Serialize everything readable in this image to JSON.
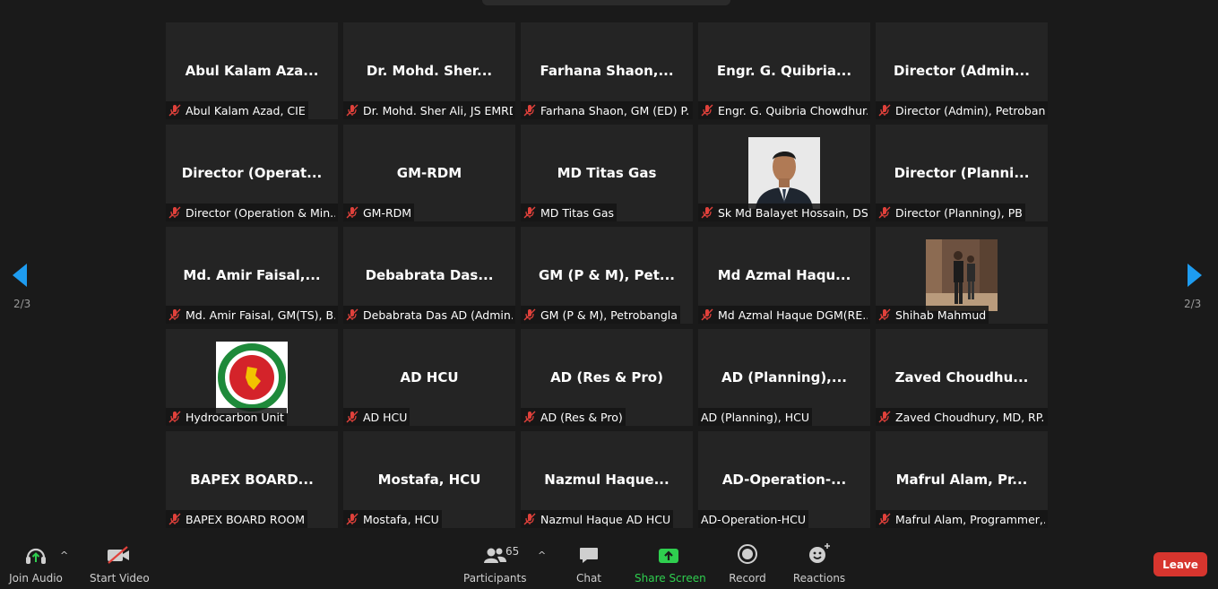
{
  "page": {
    "current": "2",
    "total": "3",
    "indicator": "2/3"
  },
  "tiles": [
    {
      "title": "Abul Kalam Aza...",
      "name": "Abul Kalam Azad, CIE",
      "muted": true,
      "photo": ""
    },
    {
      "title": "Dr. Mohd. Sher...",
      "name": "Dr. Mohd. Sher Ali, JS EMRD",
      "muted": true,
      "photo": ""
    },
    {
      "title": "Farhana  Shaon,...",
      "name": "Farhana Shaon, GM (ED) P...",
      "muted": true,
      "photo": ""
    },
    {
      "title": "Engr. G. Quibria...",
      "name": "Engr. G. Quibria Chowdhur...",
      "muted": true,
      "photo": ""
    },
    {
      "title": "Director  (Admin...",
      "name": "Director (Admin), Petroban...",
      "muted": true,
      "photo": ""
    },
    {
      "title": "Director  (Operat...",
      "name": "Director (Operation & Min...",
      "muted": true,
      "photo": ""
    },
    {
      "title": "GM-RDM",
      "name": "GM-RDM",
      "muted": true,
      "photo": ""
    },
    {
      "title": "MD Titas Gas",
      "name": "MD Titas Gas",
      "muted": true,
      "photo": ""
    },
    {
      "title": "",
      "name": "Sk Md Balayet Hossain, DS...",
      "muted": true,
      "photo": "portrait"
    },
    {
      "title": "Director  (Planni...",
      "name": "Director (Planning), PB",
      "muted": true,
      "photo": ""
    },
    {
      "title": "Md. Amir Faisal,...",
      "name": "Md. Amir Faisal, GM(TS), B...",
      "muted": true,
      "photo": ""
    },
    {
      "title": "Debabrata Das...",
      "name": "Debabrata Das AD (Admin...",
      "muted": true,
      "photo": ""
    },
    {
      "title": "GM (P & M), Pet...",
      "name": "GM (P & M), Petrobangla",
      "muted": true,
      "photo": ""
    },
    {
      "title": "Md Azmal Haqu...",
      "name": "Md Azmal Haque  DGM(RE...",
      "muted": true,
      "photo": ""
    },
    {
      "title": "",
      "name": "Shihab Mahmud",
      "muted": true,
      "photo": "standing"
    },
    {
      "title": "",
      "name": "Hydrocarbon Unit",
      "muted": true,
      "photo": "emblem"
    },
    {
      "title": "AD HCU",
      "name": "AD HCU",
      "muted": true,
      "photo": ""
    },
    {
      "title": "AD (Res & Pro)",
      "name": "AD (Res & Pro)",
      "muted": true,
      "photo": ""
    },
    {
      "title": "AD  (Planning),...",
      "name": "AD (Planning), HCU",
      "muted": false,
      "photo": ""
    },
    {
      "title": "Zaved  Choudhu...",
      "name": "Zaved Choudhury, MD, RP...",
      "muted": true,
      "photo": ""
    },
    {
      "title": "BAPEX  BOARD...",
      "name": "BAPEX BOARD ROOM",
      "muted": true,
      "photo": ""
    },
    {
      "title": "Mostafa, HCU",
      "name": "Mostafa, HCU",
      "muted": true,
      "photo": ""
    },
    {
      "title": "Nazmul  Haque...",
      "name": "Nazmul Haque AD HCU",
      "muted": true,
      "photo": ""
    },
    {
      "title": "AD-Operation-...",
      "name": "AD-Operation-HCU",
      "muted": false,
      "photo": ""
    },
    {
      "title": "Mafrul  Alam,  Pr...",
      "name": "Mafrul Alam, Programmer,...",
      "muted": true,
      "photo": ""
    }
  ],
  "toolbar": {
    "join_audio": "Join Audio",
    "start_video": "Start Video",
    "participants": "Participants",
    "participants_count": "65",
    "chat": "Chat",
    "share_screen": "Share Screen",
    "record": "Record",
    "reactions": "Reactions",
    "leave": "Leave"
  },
  "colors": {
    "accent_green": "#2fcf4f",
    "leave_red": "#d7352e",
    "nav_blue": "#1e9cf0",
    "mute_red": "#e0413b"
  },
  "icons": {
    "mute": "microphone-muted-icon",
    "left_arrow": "page-prev-icon",
    "right_arrow": "page-next-icon"
  }
}
